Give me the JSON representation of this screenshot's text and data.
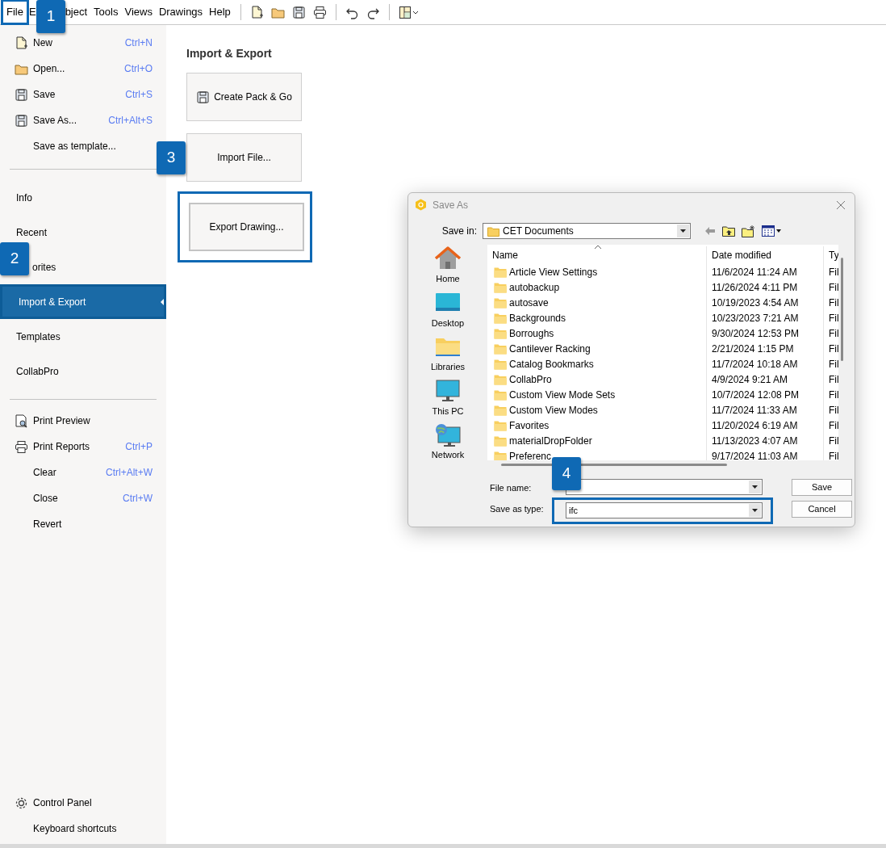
{
  "menu_bar": {
    "items": [
      {
        "label": "File",
        "highlighted": true
      },
      {
        "label": "E",
        "highlighted": false
      },
      {
        "label": "bject",
        "highlighted": false
      },
      {
        "label": "Tools",
        "highlighted": false
      },
      {
        "label": "Views",
        "highlighted": false
      },
      {
        "label": "Drawings",
        "highlighted": false
      },
      {
        "label": "Help",
        "highlighted": false
      }
    ]
  },
  "sidebar": {
    "groups": [
      [
        {
          "label": "New",
          "shortcut": "Ctrl+N",
          "selected": false
        },
        {
          "label": "Open...",
          "shortcut": "Ctrl+O",
          "selected": false
        },
        {
          "label": "Save",
          "shortcut": "Ctrl+S",
          "selected": false
        },
        {
          "label": "Save As...",
          "shortcut": "Ctrl+Alt+S",
          "selected": false
        },
        {
          "label": "Save as template...",
          "selected": false
        }
      ],
      [
        {
          "label": "Info",
          "selected": false
        },
        {
          "label": "Recent",
          "selected": false
        },
        {
          "label": "orites",
          "selected": false
        },
        {
          "label": "Import & Export",
          "selected": true
        },
        {
          "label": "Templates",
          "selected": false
        },
        {
          "label": "CollabPro",
          "selected": false
        }
      ],
      [
        {
          "label": "Print Preview",
          "selected": false
        },
        {
          "label": "Print Reports",
          "shortcut": "Ctrl+P",
          "selected": false
        },
        {
          "label": "Clear",
          "shortcut": "Ctrl+Alt+W",
          "selected": false
        },
        {
          "label": "Close",
          "shortcut": "Ctrl+W",
          "selected": false
        },
        {
          "label": "Revert",
          "selected": false
        }
      ]
    ],
    "footer": [
      {
        "label": "Control Panel"
      },
      {
        "label": "Keyboard shortcuts"
      }
    ]
  },
  "panel": {
    "title": "Import & Export",
    "buttons": [
      {
        "label": "Create Pack & Go",
        "highlighted": false
      },
      {
        "label": "Import File...",
        "highlighted": false
      },
      {
        "label": "Export Drawing...",
        "highlighted": true
      }
    ]
  },
  "dialog": {
    "title": "Save As",
    "save_in_label": "Save in:",
    "save_in": "CET Documents",
    "places": [
      "Home",
      "Desktop",
      "Libraries",
      "This PC",
      "Network"
    ],
    "columns": [
      "Name",
      "Date modified",
      "Ty"
    ],
    "rows": [
      {
        "name": "Article View Settings",
        "date": "11/6/2024 11:24 AM",
        "type": "Fil"
      },
      {
        "name": "autobackup",
        "date": "11/26/2024 4:11 PM",
        "type": "Fil"
      },
      {
        "name": "autosave",
        "date": "10/19/2023 4:54 AM",
        "type": "Fil"
      },
      {
        "name": "Backgrounds",
        "date": "10/23/2023 7:21 AM",
        "type": "Fil"
      },
      {
        "name": "Borroughs",
        "date": "9/30/2024 12:53 PM",
        "type": "Fil"
      },
      {
        "name": "Cantilever Racking",
        "date": "2/21/2024 1:15 PM",
        "type": "Fil"
      },
      {
        "name": "Catalog Bookmarks",
        "date": "11/7/2024 10:18 AM",
        "type": "Fil"
      },
      {
        "name": "CollabPro",
        "date": "4/9/2024 9:21 AM",
        "type": "Fil"
      },
      {
        "name": "Custom View Mode Sets",
        "date": "10/7/2024 12:08 PM",
        "type": "Fil"
      },
      {
        "name": "Custom View Modes",
        "date": "11/7/2024 11:33 AM",
        "type": "Fil"
      },
      {
        "name": "Favorites",
        "date": "11/20/2024 6:19 AM",
        "type": "Fil"
      },
      {
        "name": "materialDropFolder",
        "date": "11/13/2023 4:07 AM",
        "type": "Fil"
      },
      {
        "name": "Preferenc",
        "date": "9/17/2024 11:03 AM",
        "type": "Fil"
      }
    ],
    "file_name_label": "File name:",
    "save_as_type_label": "Save as type:",
    "save_as_type": "ifc",
    "save_as_type_highlighted": true,
    "buttons": [
      "Save",
      "Cancel"
    ]
  },
  "callouts": [
    "1",
    "2",
    "3",
    "4"
  ]
}
